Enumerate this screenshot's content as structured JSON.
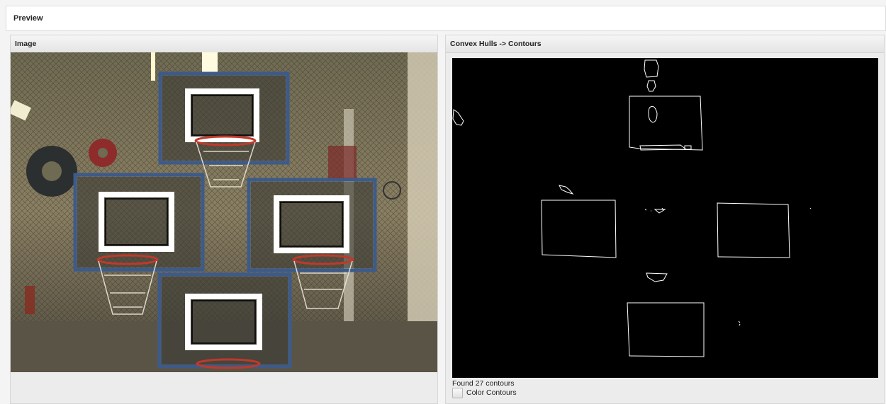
{
  "preview": {
    "title": "Preview"
  },
  "image_panel": {
    "title": "Image"
  },
  "contour_panel": {
    "title": "Convex Hulls -> Contours",
    "status": "Found 27 contours",
    "checkbox_label": "Color Contours",
    "checkbox_checked": false
  }
}
